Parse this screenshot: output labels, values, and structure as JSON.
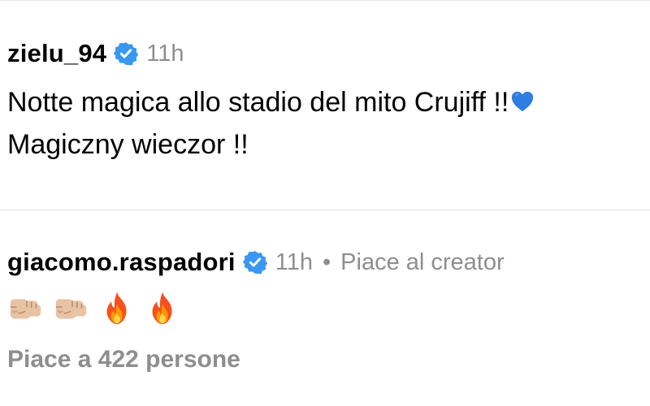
{
  "post": {
    "username": "zielu_94",
    "verified_icon": "verified-badge-icon",
    "time": "11h",
    "caption_line1": "Notte magica allo stadio del mito Crujiff !!",
    "caption_line2": "Magiczny wieczor !!",
    "caption_emoji": "blue-heart-icon"
  },
  "comment": {
    "username": "giacomo.raspadori",
    "verified_icon": "verified-badge-icon",
    "time": "11h",
    "separator": "•",
    "liked_by_creator": "Piace al creator",
    "emojis": [
      "fist-icon",
      "fist-icon",
      "fire-icon",
      "fire-icon"
    ],
    "likes": "Piace a 422 persone"
  },
  "colors": {
    "verified_blue": "#3897f0",
    "meta_gray": "#8e8e8e",
    "divider": "#e2e2e2"
  }
}
